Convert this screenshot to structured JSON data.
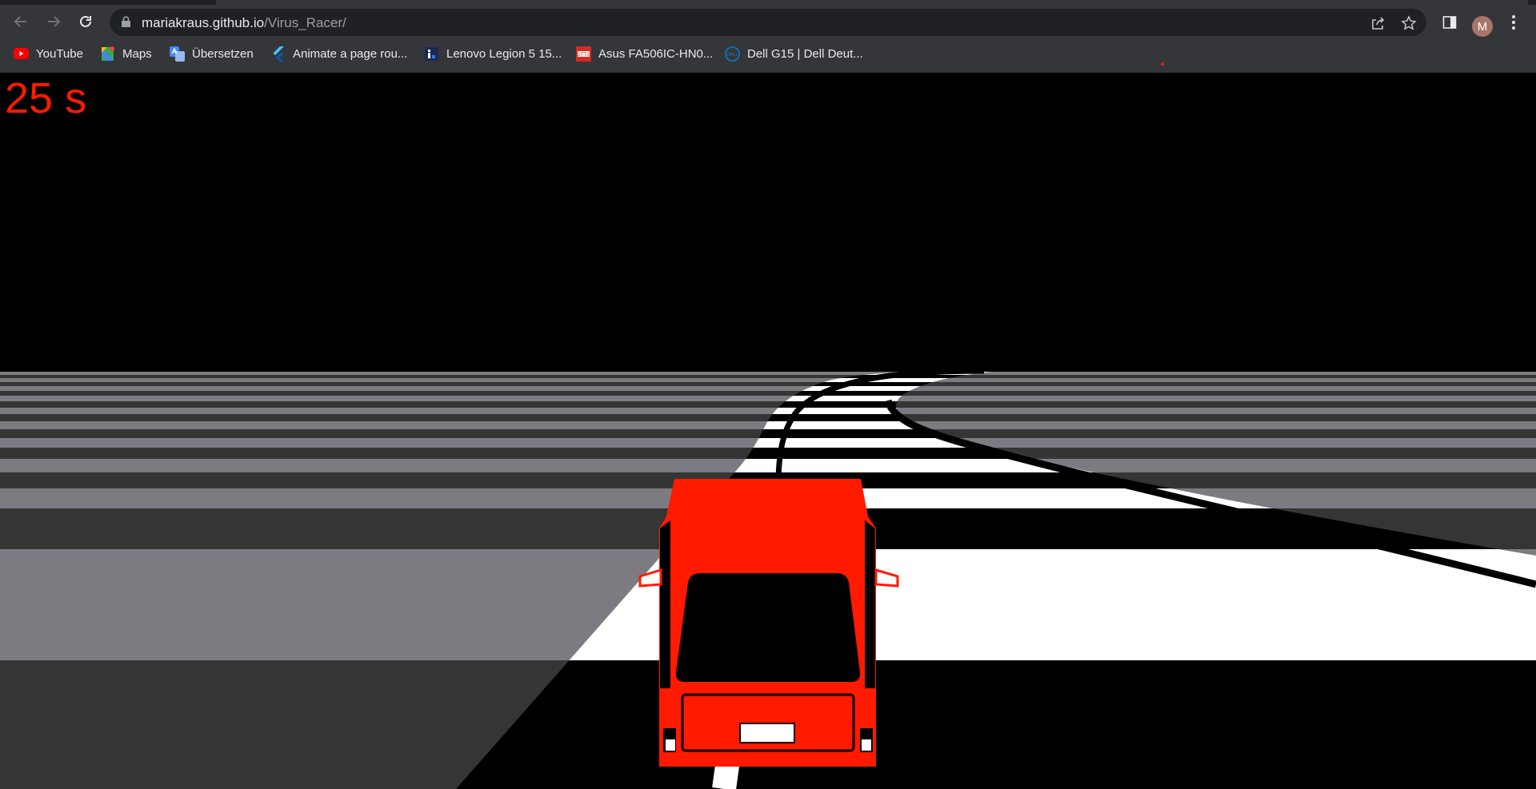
{
  "browser": {
    "url_host": "mariakraus.github.io",
    "url_path": "/Virus_Racer/",
    "profile_initial": "M",
    "bookmarks": [
      {
        "label": "YouTube",
        "icon": "youtube-icon"
      },
      {
        "label": "Maps",
        "icon": "maps-icon"
      },
      {
        "label": "Übersetzen",
        "icon": "translate-icon"
      },
      {
        "label": "Animate a page rou...",
        "icon": "flutter-icon"
      },
      {
        "label": "Lenovo Legion 5 15...",
        "icon": "info-icon"
      },
      {
        "label": "Asus FA506IC-HN0...",
        "icon": "otto-icon"
      },
      {
        "label": "Dell G15 | Dell Deut...",
        "icon": "dell-icon"
      }
    ]
  },
  "game": {
    "timer_text": "25 s",
    "timer_color": "#ff1a00",
    "car_color": "#ff1a00",
    "ground_light": "#7b7b81",
    "ground_dark": "#353535",
    "road_light": "#ffffff",
    "road_dark": "#000000"
  },
  "colors": {
    "toolbar_bg": "#35363a",
    "omnibox_bg": "#202124",
    "text": "#e8eaed",
    "text_dim": "#9aa0a6"
  }
}
